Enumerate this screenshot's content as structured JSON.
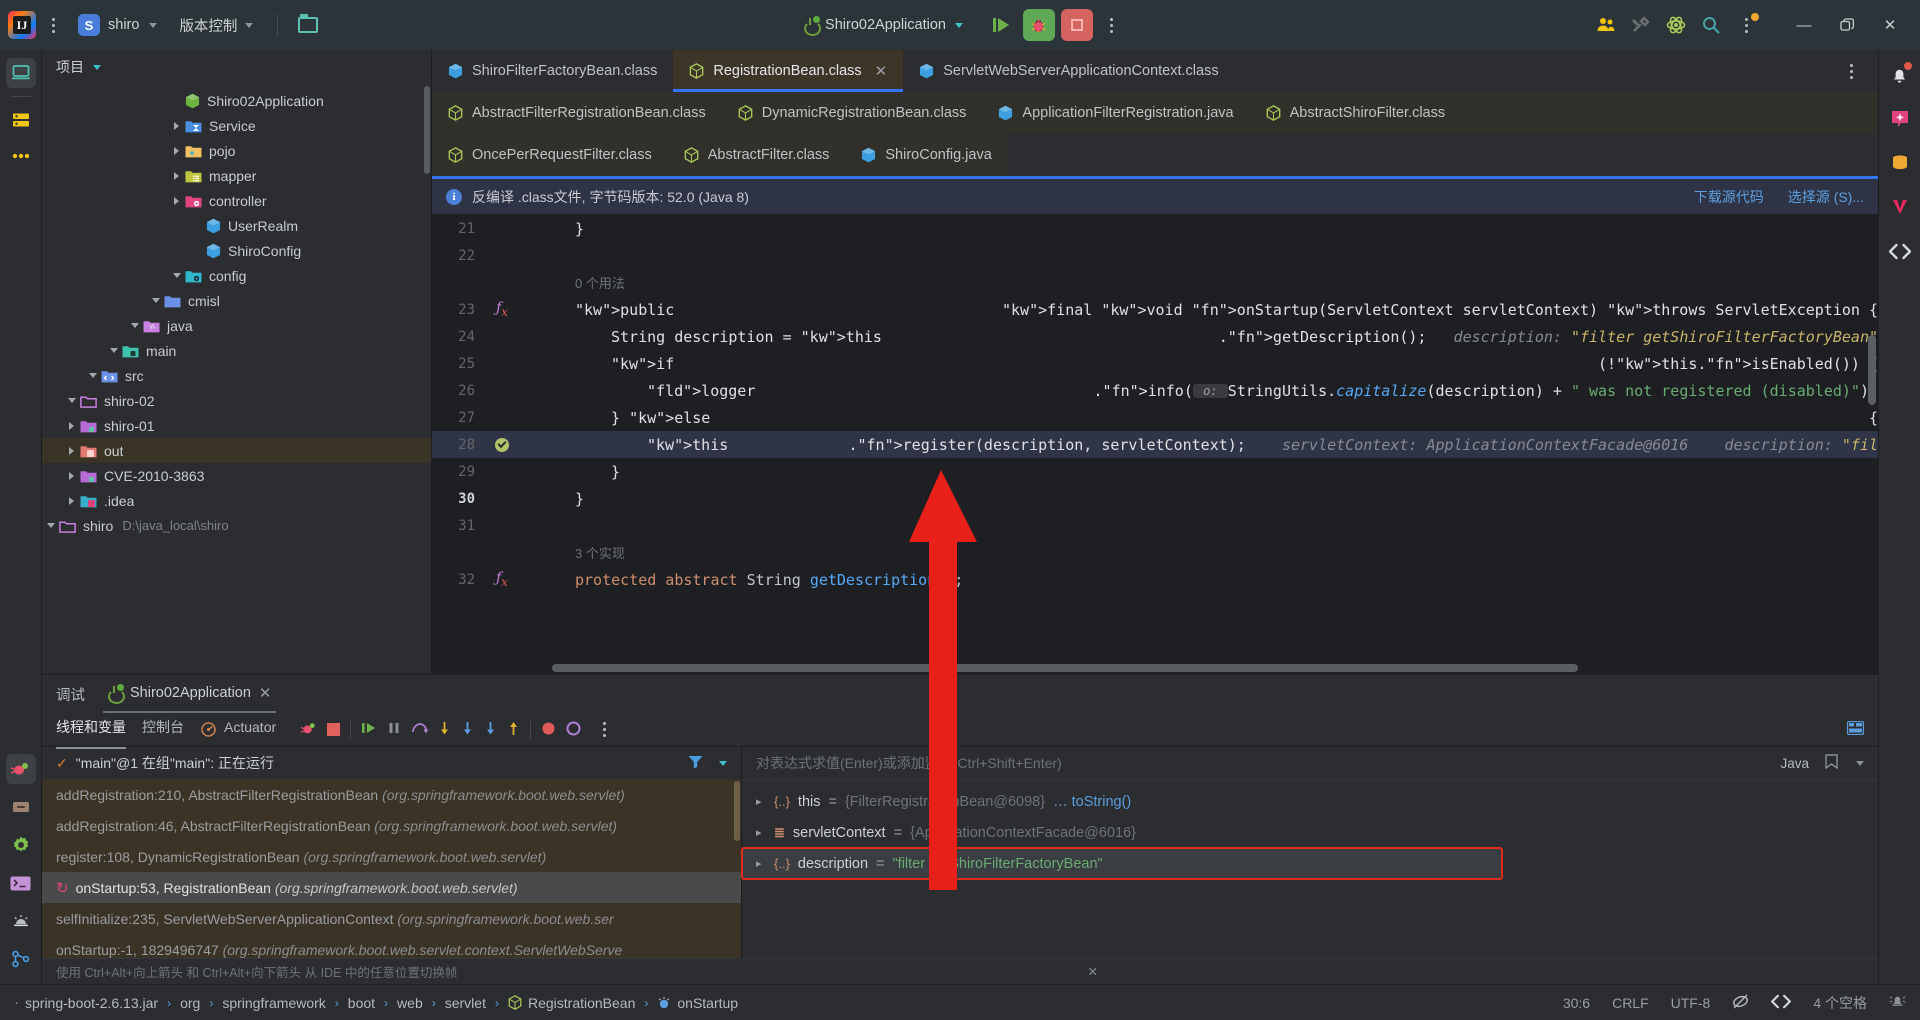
{
  "toolbar": {
    "project_initial": "S",
    "project_name": "shiro",
    "vcs_label": "版本控制",
    "run_config": "Shiro02Application",
    "icons": {
      "menu": "kebab-menu-icon",
      "folder": "open-folder-icon",
      "run": "run-icon",
      "debug": "debug-icon",
      "stop": "stop-icon",
      "more": "more-actions-icon",
      "users": "code-with-me-icon",
      "tools": "tools-icon",
      "atom": "atom-icon",
      "search": "search-icon",
      "updates": "updates-icon",
      "minimize": "minimize-icon",
      "maximize": "maximize-icon",
      "close": "close-icon"
    }
  },
  "project_panel": {
    "title": "项目",
    "tree": [
      {
        "indent": 0,
        "arrow": "down",
        "icon": "folder-outline",
        "color": "#c87fe0",
        "label": "shiro",
        "path": "D:\\java_local\\shiro",
        "selected": false
      },
      {
        "indent": 1,
        "arrow": "right",
        "icon": "folder-idea",
        "color": "#39b0c9",
        "label": ".idea",
        "path": "",
        "selected": false
      },
      {
        "indent": 1,
        "arrow": "right",
        "icon": "folder-module",
        "color": "#b66ad6",
        "label": "CVE-2010-3863",
        "path": "",
        "selected": false
      },
      {
        "indent": 1,
        "arrow": "right",
        "icon": "folder-out",
        "color": "#e07a72",
        "label": "out",
        "path": "",
        "selected": true
      },
      {
        "indent": 1,
        "arrow": "right",
        "icon": "folder-module",
        "color": "#b66ad6",
        "label": "shiro-01",
        "path": "",
        "selected": false
      },
      {
        "indent": 1,
        "arrow": "down",
        "icon": "folder-outline",
        "color": "#c87fe0",
        "label": "shiro-02",
        "path": "",
        "selected": false
      },
      {
        "indent": 2,
        "arrow": "down",
        "icon": "folder-src",
        "color": "#6c8fe8",
        "label": "src",
        "path": "",
        "selected": false
      },
      {
        "indent": 3,
        "arrow": "down",
        "icon": "folder-main",
        "color": "#3fc1ae",
        "label": "main",
        "path": "",
        "selected": false
      },
      {
        "indent": 4,
        "arrow": "down",
        "icon": "folder-java",
        "color": "#c87fe0",
        "label": "java",
        "path": "",
        "selected": false
      },
      {
        "indent": 5,
        "arrow": "down",
        "icon": "folder-pkg",
        "color": "#6c8fe8",
        "label": "cmisl",
        "path": "",
        "selected": false
      },
      {
        "indent": 6,
        "arrow": "down",
        "icon": "folder-config",
        "color": "#2eb8c9",
        "label": "config",
        "path": "",
        "selected": false
      },
      {
        "indent": 7,
        "arrow": "none",
        "icon": "class-java",
        "color": "#3d9ee0",
        "label": "ShiroConfig",
        "path": "",
        "selected": false
      },
      {
        "indent": 7,
        "arrow": "none",
        "icon": "class-java",
        "color": "#3d9ee0",
        "label": "UserRealm",
        "path": "",
        "selected": false
      },
      {
        "indent": 6,
        "arrow": "right",
        "icon": "folder-ctrl",
        "color": "#e0437f",
        "label": "controller",
        "path": "",
        "selected": false
      },
      {
        "indent": 6,
        "arrow": "right",
        "icon": "folder-mapper",
        "color": "#bfc33d",
        "label": "mapper",
        "path": "",
        "selected": false
      },
      {
        "indent": 6,
        "arrow": "right",
        "icon": "folder-pojo",
        "color": "#f0c164",
        "label": "pojo",
        "path": "",
        "selected": false
      },
      {
        "indent": 6,
        "arrow": "right",
        "icon": "folder-service",
        "color": "#4a8fe0",
        "label": "Service",
        "path": "",
        "selected": false
      },
      {
        "indent": 6,
        "arrow": "none",
        "icon": "class-spring",
        "color": "#6db33f",
        "label": "Shiro02Application",
        "path": "",
        "selected": false
      }
    ]
  },
  "editor": {
    "tab_rows": [
      [
        {
          "label": "ShiroFilterFactoryBean.class",
          "icon": "class-blue",
          "active": false,
          "closable": false
        },
        {
          "label": "RegistrationBean.class",
          "icon": "class-green",
          "active": true,
          "closable": true
        },
        {
          "label": "ServletWebServerApplicationContext.class",
          "icon": "class-blue",
          "active": false,
          "closable": false
        }
      ],
      [
        {
          "label": "AbstractFilterRegistrationBean.class",
          "icon": "class-green",
          "active": false,
          "closable": false
        },
        {
          "label": "DynamicRegistrationBean.class",
          "icon": "class-green",
          "active": false,
          "closable": false
        },
        {
          "label": "ApplicationFilterRegistration.java",
          "icon": "class-blue",
          "active": false,
          "closable": false
        },
        {
          "label": "AbstractShiroFilter.class",
          "icon": "class-green",
          "active": false,
          "closable": false
        }
      ],
      [
        {
          "label": "OncePerRequestFilter.class",
          "icon": "class-green",
          "active": false,
          "closable": false
        },
        {
          "label": "AbstractFilter.class",
          "icon": "class-green",
          "active": false,
          "closable": false
        },
        {
          "label": "ShiroConfig.java",
          "icon": "class-blue",
          "active": false,
          "closable": false
        }
      ]
    ],
    "banner": {
      "text": "反编译 .class文件, 字节码版本: 52.0 (Java 8)",
      "link_download": "下载源代码",
      "link_choose": "选择源 (S)..."
    },
    "usage_hint_1": "0 个用法",
    "usage_hint_2": "3 个实现",
    "lines": [
      {
        "num": "21",
        "mark": "",
        "indent": 1,
        "html": "}"
      },
      {
        "num": "22",
        "mark": "",
        "indent": 0,
        "html": ""
      },
      {
        "num": "",
        "mark": "",
        "indent": 1,
        "usage": "0 个用法"
      },
      {
        "num": "23",
        "mark": "fx",
        "indent": 1,
        "html": "public final void onStartup(ServletContext servletContext) throws ServletException {"
      },
      {
        "num": "24",
        "mark": "",
        "indent": 2,
        "html": "String description = this.getDescription();   description: \"filter getShiroFilterFactoryBean\""
      },
      {
        "num": "25",
        "mark": "",
        "indent": 2,
        "html": "if (!this.isEnabled()) {"
      },
      {
        "num": "26",
        "mark": "",
        "indent": 3,
        "html": "logger.info( o: StringUtils.capitalize(description) + \" was not registered (disabled)\");"
      },
      {
        "num": "27",
        "mark": "",
        "indent": 2,
        "html": "} else {"
      },
      {
        "num": "28",
        "mark": "bp",
        "indent": 3,
        "html": "this.register(description, servletContext);    servletContext: ApplicationContextFacade@6016    description: \"fil"
      },
      {
        "num": "29",
        "mark": "",
        "indent": 2,
        "html": "}"
      },
      {
        "num": "30",
        "mark": "",
        "indent": 1,
        "html": "}"
      },
      {
        "num": "31",
        "mark": "",
        "indent": 0,
        "html": ""
      },
      {
        "num": "",
        "mark": "",
        "indent": 1,
        "usage": "3 个实现"
      },
      {
        "num": "32",
        "mark": "fx",
        "indent": 1,
        "html": "protected abstract String getDescription();"
      }
    ]
  },
  "debug": {
    "panel_title": "调试",
    "run_tab": "Shiro02Application",
    "tabs": [
      {
        "label": "线程和变量",
        "selected": true
      },
      {
        "label": "控制台",
        "selected": false
      },
      {
        "label": "Actuator",
        "selected": false
      }
    ],
    "thread_status": "\"main\"@1 在组\"main\": 正在运行",
    "frames": [
      {
        "text": "addRegistration:210, AbstractFilterRegistrationBean",
        "pkg": "(org.springframework.boot.web.servlet)",
        "current": false
      },
      {
        "text": "addRegistration:46, AbstractFilterRegistrationBean",
        "pkg": "(org.springframework.boot.web.servlet)",
        "current": false
      },
      {
        "text": "register:108, DynamicRegistrationBean",
        "pkg": "(org.springframework.boot.web.servlet)",
        "current": false
      },
      {
        "text": "onStartup:53, RegistrationBean",
        "pkg": "(org.springframework.boot.web.servlet)",
        "current": true
      },
      {
        "text": "selfInitialize:235, ServletWebServerApplicationContext",
        "pkg": "(org.springframework.boot.web.ser",
        "current": false
      },
      {
        "text": "onStartup:-1, 1829496747",
        "pkg": "(org.springframework.boot.web.servlet.context.ServletWebServe",
        "current": false
      }
    ],
    "watch_placeholder": "对表达式求值(Enter)或添加监视(Ctrl+Shift+Enter)",
    "lang_label": "Java",
    "variables": [
      {
        "name": "this",
        "icon": "{..}",
        "value": "{FilterRegistrationBean@6098}",
        "extra": "… toString()",
        "kind": "obj",
        "selected": false
      },
      {
        "name": "servletContext",
        "icon": "list",
        "value": "{ApplicationContextFacade@6016}",
        "extra": "",
        "kind": "obj",
        "selected": false
      },
      {
        "name": "description",
        "icon": "{..}",
        "value": "\"filter getShiroFilterFactoryBean\"",
        "extra": "",
        "kind": "str",
        "selected": true
      }
    ],
    "hint_text": "使用 Ctrl+Alt+向上箭头 和 Ctrl+Alt+向下箭头 从 IDE 中的任意位置切换帧"
  },
  "status_bar": {
    "breadcrumbs": [
      {
        "label": "spring-boot-2.6.13.jar",
        "icon": "jar-icon"
      },
      {
        "label": "org",
        "icon": ""
      },
      {
        "label": "springframework",
        "icon": ""
      },
      {
        "label": "boot",
        "icon": ""
      },
      {
        "label": "web",
        "icon": ""
      },
      {
        "label": "servlet",
        "icon": ""
      },
      {
        "label": "RegistrationBean",
        "icon": "class-green"
      },
      {
        "label": "onStartup",
        "icon": "method-icon"
      }
    ],
    "caret": "30:6",
    "line_sep": "CRLF",
    "encoding": "UTF-8",
    "indent": "4 个空格",
    "icons": [
      "read-only-icon",
      "code-style-icon",
      "notifications-icon"
    ]
  },
  "rails": {
    "left_top": [
      "project-icon",
      "commit-icon",
      "more-tool-windows-icon"
    ],
    "left_bottom": [
      "debug-icon",
      "build-icon",
      "services-icon",
      "terminal-icon",
      "problems-icon",
      "git-icon"
    ],
    "right": [
      "notifications-bell-icon",
      "ai-assistant-icon",
      "database-icon",
      "vue-icon",
      "code-with-me-icon"
    ]
  },
  "colors": {
    "accent": "#3574f0",
    "selected_tab_bg": "#3e3529",
    "annotation_red": "#e8201a",
    "run_green": "#5fa855",
    "stop_red": "#d5635f"
  }
}
